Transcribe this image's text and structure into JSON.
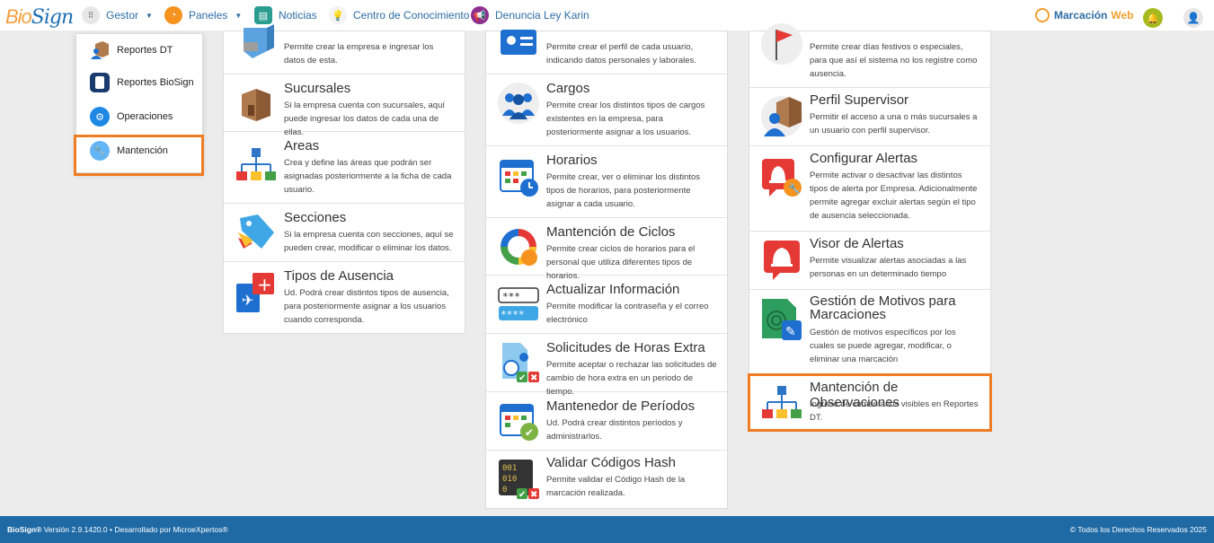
{
  "logo": {
    "part1": "Bio",
    "part2": "Sign"
  },
  "nav": {
    "gestor": "Gestor",
    "paneles": "Paneles",
    "noticias": "Noticias",
    "centro": "Centro de Conocimiento",
    "denuncia": "Denuncia Ley Karin",
    "marcacion": "Marcación",
    "marcacion_web": "Web"
  },
  "dropdown": [
    {
      "label": "Reportes DT"
    },
    {
      "label": "Reportes BioSign"
    },
    {
      "label": "Operaciones"
    },
    {
      "label": "Mantención"
    }
  ],
  "col1": [
    {
      "title": "",
      "desc": "Permite crear la empresa e ingresar los datos de esta."
    },
    {
      "title": "Sucursales",
      "desc": "Si la empresa cuenta con sucursales, aquí puede ingresar los datos de cada una de ellas."
    },
    {
      "title": "Areas",
      "desc": "Crea y define las áreas que podrán ser asignadas posteriormente a la ficha de cada usuario."
    },
    {
      "title": "Secciones",
      "desc": "Si la empresa cuenta con secciones, aquí se pueden crear, modificar o eliminar los datos."
    },
    {
      "title": "Tipos de Ausencia",
      "desc": "Ud. Podrá crear distintos tipos de ausencia, para posteriormente asignar a los usuarios cuando corresponda."
    }
  ],
  "col2": [
    {
      "title": "",
      "desc": "Permite crear el perfil de cada usuario, indicando datos personales y laborales."
    },
    {
      "title": "Cargos",
      "desc": "Permite crear los distintos tipos de cargos existentes en la empresa, para posteriormente asignar a los usuarios."
    },
    {
      "title": "Horarios",
      "desc": "Permite crear, ver o eliminar los distintos tipos de horarios, para posteriormente asignar a cada usuario."
    },
    {
      "title": "Mantención de Ciclos",
      "desc": "Permite crear ciclos de horarios para el personal que utiliza diferentes tipos de horarios."
    },
    {
      "title": "Actualizar Información",
      "desc": "Permite modificar la contraseña y el correo electrónico"
    },
    {
      "title": "Solicitudes de Horas Extra",
      "desc": "Permite aceptar o rechazar las solicitudes de cambio de hora extra en un periodo de tiempo."
    },
    {
      "title": "Mantenedor de Períodos",
      "desc": "Ud. Podrá crear distintos períodos y administrarlos."
    },
    {
      "title": "Validar Códigos Hash",
      "desc": "Permite validar el Código Hash de la marcación realizada."
    }
  ],
  "col3": [
    {
      "title": "",
      "desc": "Permite crear días festivos o especiales, para que así el sistema no los registre como ausencia."
    },
    {
      "title": "Perfil Supervisor",
      "desc": "Permitir el acceso a una o más sucursales a un usuario con perfil supervisor."
    },
    {
      "title": "Configurar Alertas",
      "desc": "Permite activar o desactivar las distintos tipos de alerta por Empresa. Adicionalmente permite agregar excluir alertas según el tipo de ausencia seleccionada."
    },
    {
      "title": "Visor de Alertas",
      "desc": "Permite visualizar alertas asociadas a las personas en un determinado tiempo"
    },
    {
      "title": "Gestión de Motivos para Marcaciones",
      "desc": "Gestión de motivos específicos por los cuales se puede agregar, modificar, o eliminar una marcación"
    },
    {
      "title": "Mantención de Observaciones",
      "desc": "Ingreso de comentarios visibles en Reportes DT."
    }
  ],
  "hash_icon_text": [
    "001",
    "010",
    "0"
  ],
  "password_icon_text": [
    "***",
    "****"
  ],
  "footer": {
    "left_brand": "BioSign®",
    "left_rest": " Versión 2.9.1420.0 • Desarrollado por MicroeXpertos®",
    "right": "© Todos los Derechos Reservados 2025"
  },
  "colors": {
    "accent": "#1f6aa5",
    "highlight": "#f07c23",
    "orange": "#f2a03d"
  }
}
